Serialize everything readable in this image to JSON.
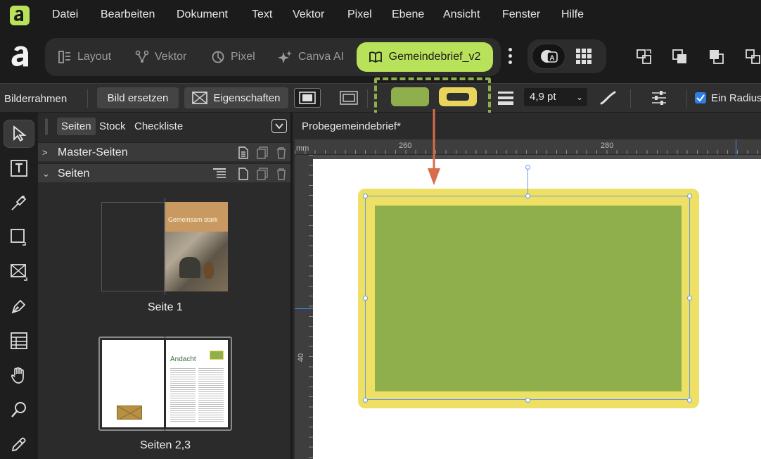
{
  "menu": {
    "items": [
      "Datei",
      "Bearbeiten",
      "Dokument",
      "Text",
      "Vektor",
      "Pixel",
      "Ebene",
      "Ansicht",
      "Fenster",
      "Hilfe"
    ]
  },
  "personas": {
    "layout": "Layout",
    "vektor": "Vektor",
    "pixel": "Pixel",
    "canva_ai": "Canva AI",
    "active_document": "Gemeindebrief_v2"
  },
  "context_toolbar": {
    "label": "Bilderrahmen",
    "replace_image": "Bild ersetzen",
    "properties": "Eigenschaften",
    "stroke_width": "4,9 pt",
    "radius_option": "Ein Radius",
    "radius_checked": true
  },
  "colors": {
    "accent": "#b9e25b",
    "fill": "#8fae4c",
    "stroke": "#e9d55c",
    "arrow": "#d96c4a",
    "selection": "#6d9be8"
  },
  "panel": {
    "tabs": [
      "Seiten",
      "Stock",
      "Checkliste"
    ],
    "active_tab": "Seiten",
    "master_pages": "Master-Seiten",
    "pages": "Seiten",
    "thumbs": [
      {
        "label": "Seite 1",
        "cover_title": "Gemeinsam stark"
      },
      {
        "label": "Seiten 2,3",
        "heading": "Andacht"
      }
    ]
  },
  "document": {
    "tab_title": "Probegemeindebrief*",
    "ruler_unit": "mm",
    "ruler_top": [
      "260",
      "280"
    ],
    "ruler_left": [
      "40"
    ]
  }
}
